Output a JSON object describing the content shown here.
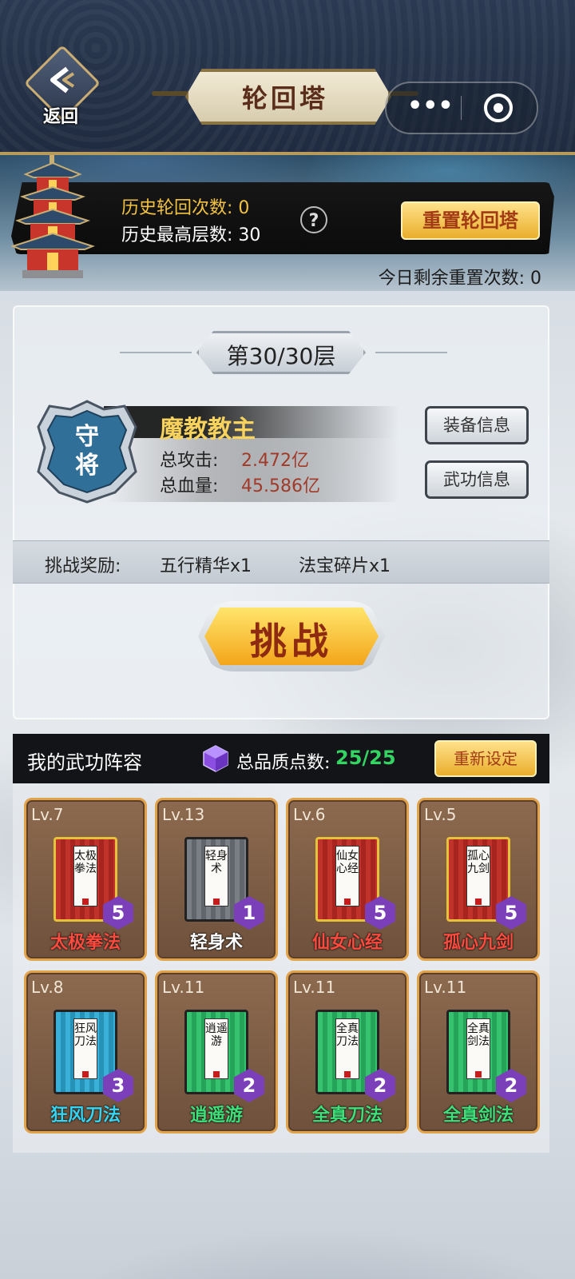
{
  "header": {
    "back_label": "返回",
    "title": "轮回塔"
  },
  "banner": {
    "history_count_label": "历史轮回次数: 0",
    "history_max_label": "历史最高层数: 30",
    "help_symbol": "?",
    "reset_tower_label": "重置轮回塔",
    "reset_remaining_label": "今日剩余重置次数: 0"
  },
  "challenge": {
    "floor_label": "第30/30层",
    "badge_text": [
      "守",
      "将"
    ],
    "boss_name": "魔教教主",
    "attack_label": "总攻击:",
    "attack_value": "2.472亿",
    "hp_label": "总血量:",
    "hp_value": "45.586亿",
    "equip_info_label": "装备信息",
    "skill_info_label": "武功信息",
    "reward_label": "挑战奖励:",
    "reward_1": "五行精华x1",
    "reward_2": "法宝碎片x1",
    "challenge_button": "挑战"
  },
  "lineup": {
    "title": "我的武功阵容",
    "quality_label": "总品质点数:",
    "quality_value": "25/25",
    "reset_label": "重新设定",
    "cards": [
      {
        "level": "Lv.7",
        "name": "太极拳法",
        "cover": "太极拳法",
        "grade": "5",
        "name_color": "#ff4a3d"
      },
      {
        "level": "Lv.13",
        "name": "轻身术",
        "cover": "轻身术",
        "grade": "1",
        "name_color": "#ffffff"
      },
      {
        "level": "Lv.6",
        "name": "仙女心经",
        "cover": "仙女心经",
        "grade": "5",
        "name_color": "#ff4a3d"
      },
      {
        "level": "Lv.5",
        "name": "孤心九剑",
        "cover": "孤心九剑",
        "grade": "5",
        "name_color": "#ff4a3d"
      },
      {
        "level": "Lv.8",
        "name": "狂风刀法",
        "cover": "狂风刀法",
        "grade": "3",
        "name_color": "#35d4f2"
      },
      {
        "level": "Lv.11",
        "name": "逍遥游",
        "cover": "逍遥游",
        "grade": "2",
        "name_color": "#3ee07a"
      },
      {
        "level": "Lv.11",
        "name": "全真刀法",
        "cover": "全真刀法",
        "grade": "2",
        "name_color": "#3ee07a"
      },
      {
        "level": "Lv.11",
        "name": "全真剑法",
        "cover": "全真剑法",
        "grade": "2",
        "name_color": "#3ee07a"
      }
    ]
  },
  "icons": {
    "back": "back-arrow-icon",
    "more": "more-dots-icon",
    "target": "target-icon",
    "help": "help-icon",
    "gem": "purple-gem-icon"
  },
  "colors": {
    "gold": "#f3c241",
    "boss_name": "#f7d25c",
    "stat_value": "#a13a28",
    "quality_value": "#34d463"
  }
}
